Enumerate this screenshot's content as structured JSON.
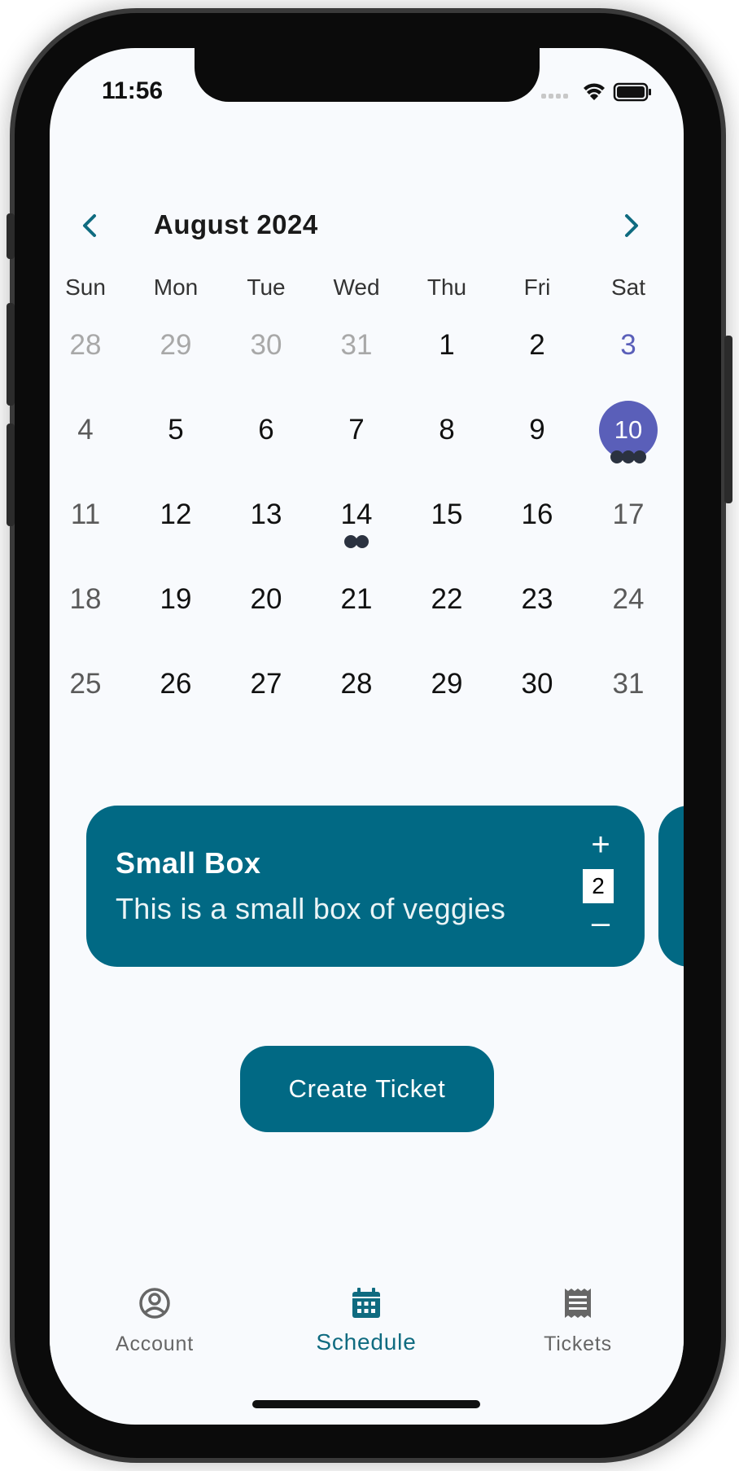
{
  "status_bar": {
    "time": "11:56"
  },
  "calendar": {
    "month_title": "August 2024",
    "prev_icon": "chevron-left-icon",
    "next_icon": "chevron-right-icon",
    "weekdays": [
      "Sun",
      "Mon",
      "Tue",
      "Wed",
      "Thu",
      "Fri",
      "Sat"
    ],
    "weeks": [
      [
        "28",
        "29",
        "30",
        "31",
        "1",
        "2",
        "3"
      ],
      [
        "4",
        "5",
        "6",
        "7",
        "8",
        "9",
        "10"
      ],
      [
        "11",
        "12",
        "13",
        "14",
        "15",
        "16",
        "17"
      ],
      [
        "18",
        "19",
        "20",
        "21",
        "22",
        "23",
        "24"
      ],
      [
        "25",
        "26",
        "27",
        "28",
        "29",
        "30",
        "31"
      ]
    ],
    "selected_day": "10",
    "today_day": "3",
    "event_dots": {
      "10": 3,
      "14": 2
    },
    "colors": {
      "selected": "#5a5fb9",
      "accent": "#0f6b80",
      "muted": "#a8a8a8"
    }
  },
  "product": {
    "title": "Small Box",
    "description": "This is a small box of veggies",
    "quantity": "2",
    "plus_label": "+",
    "minus_label": "–",
    "card_color": "#016984"
  },
  "actions": {
    "create_ticket": "Create Ticket"
  },
  "tabbar": {
    "tabs": [
      {
        "label": "Account",
        "icon": "account-circle-icon"
      },
      {
        "label": "Schedule",
        "icon": "calendar-icon"
      },
      {
        "label": "Tickets",
        "icon": "receipt-icon"
      }
    ],
    "active": "Schedule"
  }
}
